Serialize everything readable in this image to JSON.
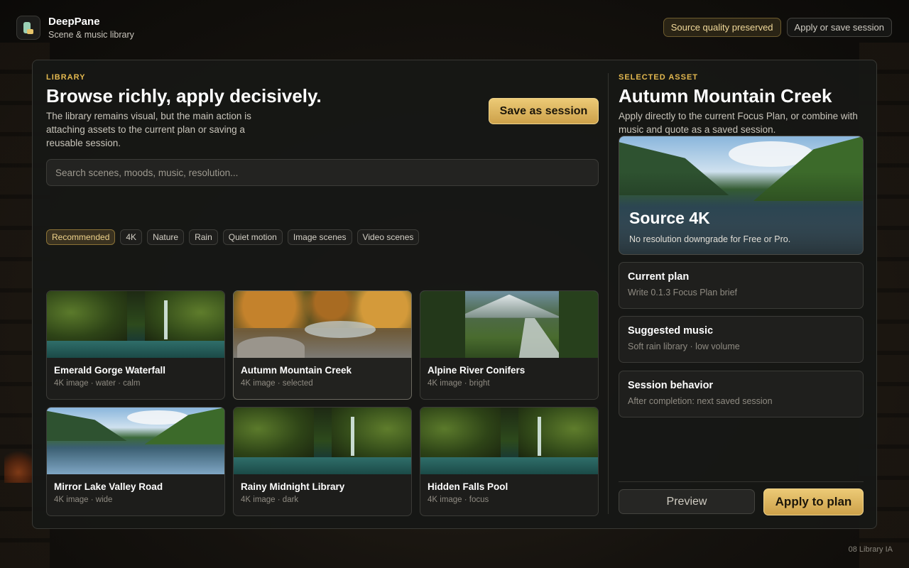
{
  "app": {
    "name": "DeepPane",
    "subtitle": "Scene & music library",
    "quality_badge": "Source quality preserved",
    "apply_save_label": "Apply or save session"
  },
  "library": {
    "eyebrow": "LIBRARY",
    "title": "Browse richly, apply decisively.",
    "description": "The library remains visual, but the main action is attaching assets to the current plan or saving a reusable session.",
    "save_button": "Save as session",
    "search_placeholder": "Search scenes, moods, music, resolution...",
    "filters": [
      {
        "label": "Recommended",
        "active": true
      },
      {
        "label": "4K",
        "active": false
      },
      {
        "label": "Nature",
        "active": false
      },
      {
        "label": "Rain",
        "active": false
      },
      {
        "label": "Quiet motion",
        "active": false
      },
      {
        "label": "Image scenes",
        "active": false
      },
      {
        "label": "Video scenes",
        "active": false
      }
    ],
    "cards": [
      {
        "title": "Emerald Gorge Waterfall",
        "meta": "4K image · water · calm"
      },
      {
        "title": "Autumn Mountain Creek",
        "meta": "4K image · selected"
      },
      {
        "title": "Alpine River Conifers",
        "meta": "4K image · bright"
      },
      {
        "title": "Mirror Lake Valley Road",
        "meta": "4K image · wide"
      },
      {
        "title": "Rainy Midnight Library",
        "meta": "4K image · dark"
      },
      {
        "title": "Hidden Falls Pool",
        "meta": "4K image · focus"
      }
    ]
  },
  "selected": {
    "eyebrow": "SELECTED ASSET",
    "title": "Autumn Mountain Creek",
    "description": "Apply directly to the current Focus Plan, or combine with music and quote as a saved session.",
    "hero_title": "Source 4K",
    "hero_subtitle": "No resolution downgrade for Free or Pro.",
    "info": [
      {
        "title": "Current plan",
        "sub": "Write 0.1.3 Focus Plan brief"
      },
      {
        "title": "Suggested music",
        "sub": "Soft rain library · low volume"
      },
      {
        "title": "Session behavior",
        "sub": "After completion: next saved session"
      }
    ],
    "preview_button": "Preview",
    "apply_button": "Apply to plan"
  },
  "footer": "08 Library IA",
  "colors": {
    "accent": "#e3b84f",
    "panel": "#161715"
  }
}
